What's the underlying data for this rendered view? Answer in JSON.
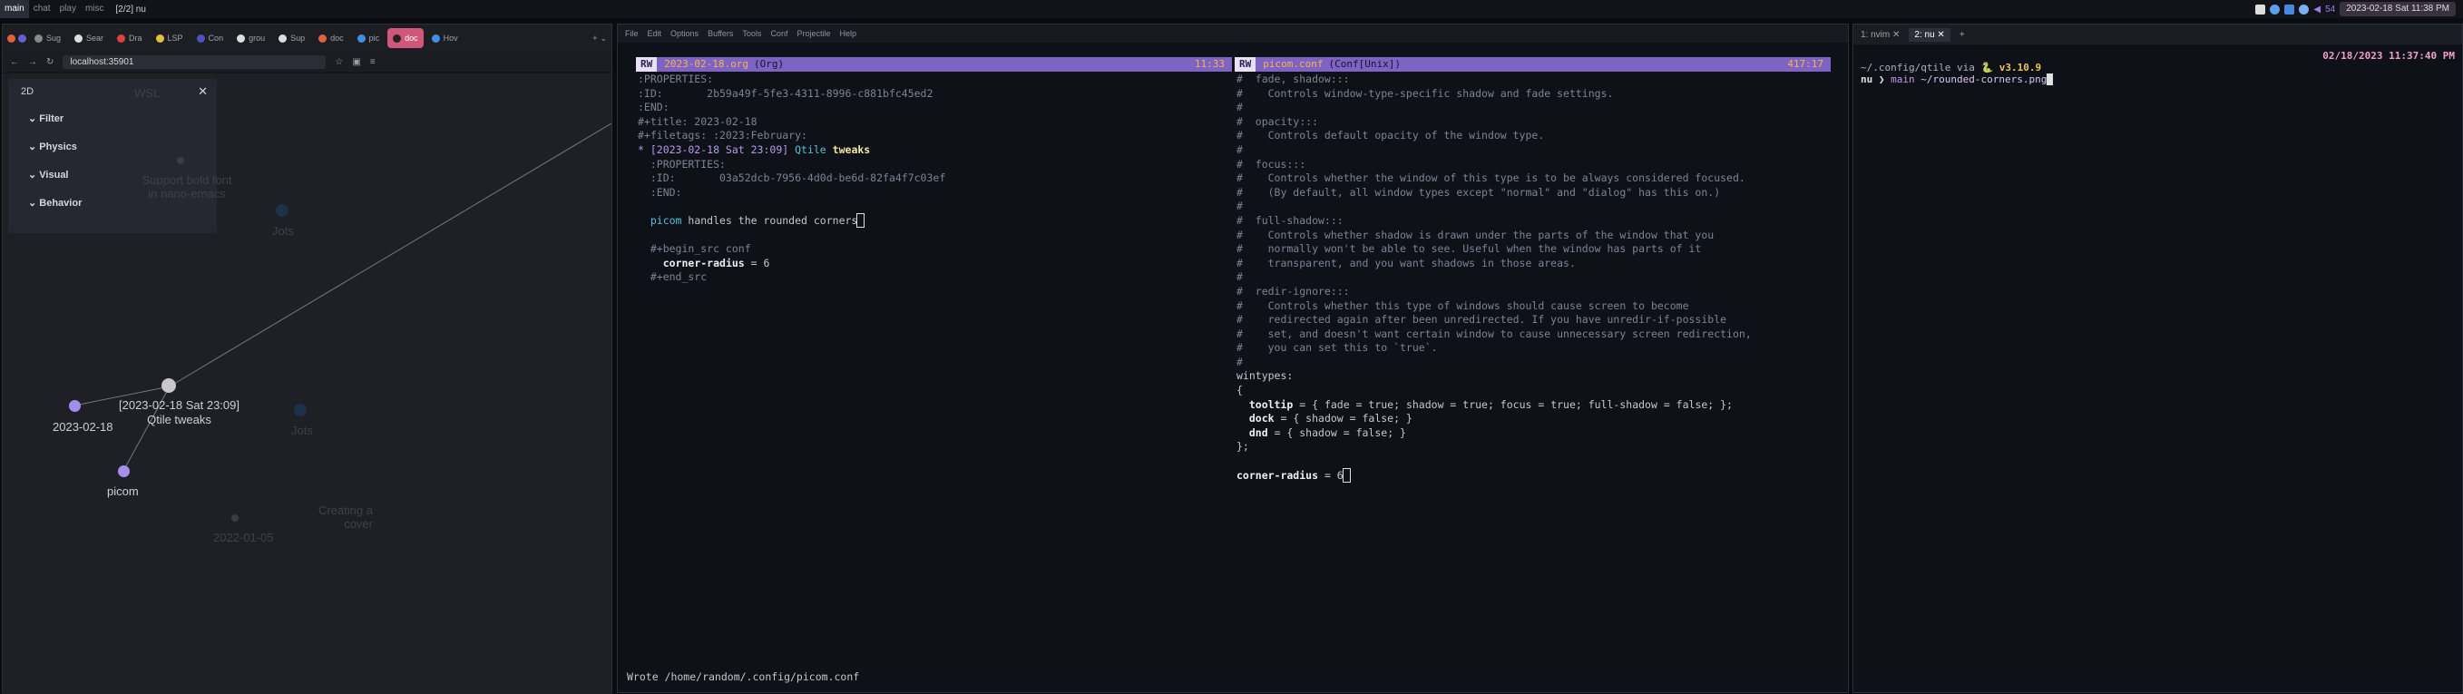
{
  "bar": {
    "groups": [
      "main",
      "chat",
      "play",
      "misc"
    ],
    "window_name": "[2/2] nu",
    "clock": "2023-02-18 Sat 11:38 PM",
    "volume": "54"
  },
  "browser": {
    "tabs": [
      "Sug",
      "Sear",
      "Dra",
      "LSP",
      "Con",
      "grou",
      "Sup",
      "doc",
      "pic",
      "doc",
      "Hov"
    ],
    "url": "localhost:35901",
    "panel": {
      "title": "2D",
      "items": [
        "Filter",
        "Physics",
        "Visual",
        "Behavior"
      ]
    },
    "nodes": {
      "wsl": "WSL",
      "bold": "Support bold font in nano-emacs",
      "jots1": "Jots",
      "date": "2023-02-18",
      "tweaks_line1": "[2023-02-18 Sat 23:09]",
      "tweaks_line2": "Qtile tweaks",
      "jots2": "Jots",
      "picom": "picom",
      "creating_line1": "Creating a",
      "creating_line2": "cover",
      "old": "2022-01-05"
    }
  },
  "emacs": {
    "menu": [
      "File",
      "Edit",
      "Options",
      "Buffers",
      "Tools",
      "Conf",
      "Projectile",
      "Help"
    ],
    "left": {
      "rw": "RW",
      "file": "2023-02-18.org",
      "mode": "(Org)",
      "pos": "11:33"
    },
    "right": {
      "rw": "RW",
      "file": "picom.conf",
      "mode": "(Conf[Unix])",
      "pos": "417:17"
    },
    "echo": "Wrote /home/random/.config/picom.conf"
  },
  "term": {
    "tabs": [
      "1: nvim",
      "2: nu"
    ],
    "timestamp": "02/18/2023 11:37:40 PM",
    "prompt_dir": "~/.config/qtile",
    "prompt_via": "via",
    "prompt_py": "🐍 v3.10.9",
    "line2_a": "nu",
    "line2_b": "❯",
    "line2_c": "main",
    "command": "~/rounded-corners.png"
  }
}
